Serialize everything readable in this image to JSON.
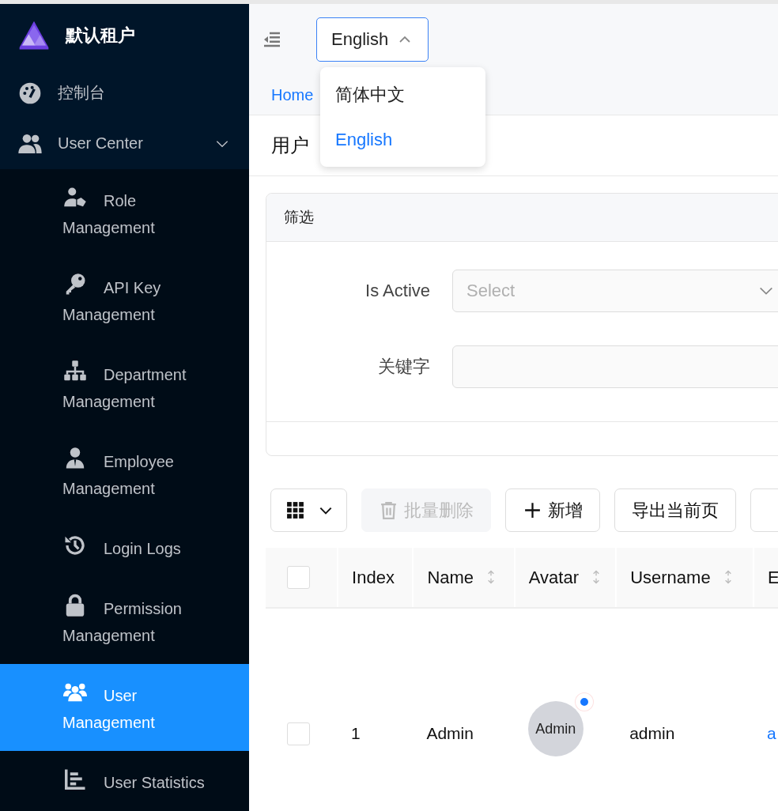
{
  "sidebar": {
    "brand": "默认租户",
    "items": [
      {
        "kind": "item",
        "label": "控制台",
        "selected": false
      },
      {
        "kind": "group",
        "label": "User Center",
        "expanded": true,
        "children": [
          {
            "label": "Role Management",
            "selected": false
          },
          {
            "label": "API Key Management",
            "selected": false
          },
          {
            "label": "Department Management",
            "selected": false
          },
          {
            "label": "Employee Management",
            "selected": false
          },
          {
            "label": "Login Logs",
            "selected": false
          },
          {
            "label": "Permission Management",
            "selected": false
          },
          {
            "label": "User Management",
            "selected": true
          },
          {
            "label": "User Statistics",
            "selected": false
          }
        ]
      }
    ]
  },
  "header": {
    "language_select": {
      "value": "English",
      "expanded": true,
      "options": [
        {
          "label": "简体中文",
          "selected": false
        },
        {
          "label": "English",
          "selected": true
        }
      ]
    }
  },
  "breadcrumb": [
    "Home"
  ],
  "page_title": "用户",
  "filter": {
    "title": "筛选",
    "fields": [
      {
        "kind": "select",
        "label": "Is Active",
        "placeholder": "Select"
      },
      {
        "kind": "input",
        "label": "关键字"
      }
    ]
  },
  "toolbar": [
    {
      "kind": "columns"
    },
    {
      "kind": "delete",
      "label": "批量删除",
      "disabled": true
    },
    {
      "kind": "add",
      "label": "新增",
      "disabled": false
    },
    {
      "kind": "plain",
      "label": "导出当前页",
      "disabled": false
    },
    {
      "kind": "plain",
      "disabled": false
    }
  ],
  "table": {
    "header_checked": false,
    "columns": [
      {
        "label": "Index",
        "sortable": false
      },
      {
        "label": "Name",
        "sortable": true
      },
      {
        "label": "Avatar",
        "sortable": true
      },
      {
        "label": "Username",
        "sortable": true
      },
      {
        "label": "E"
      }
    ],
    "rows": [
      {
        "checked": false,
        "index": "1",
        "name": "Admin",
        "avatar": "Admin",
        "avatar_dot": true,
        "username": "admin",
        "column_5": "a"
      }
    ]
  }
}
